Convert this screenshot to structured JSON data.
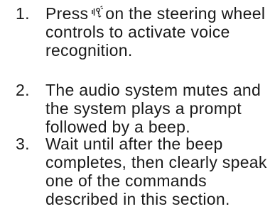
{
  "steps": [
    {
      "number": "1.",
      "lines": [
        "Press",
        "on the steering wheel",
        "controls to activate voice",
        "recognition."
      ],
      "icon": "voice-recognition-icon"
    },
    {
      "number": "2.",
      "lines": [
        "The audio system mutes and",
        "the system plays a prompt",
        "followed by a beep."
      ]
    },
    {
      "number": "3.",
      "lines": [
        "Wait until after the beep",
        "completes, then clearly speak",
        "one of the commands",
        "described in this section."
      ]
    }
  ]
}
